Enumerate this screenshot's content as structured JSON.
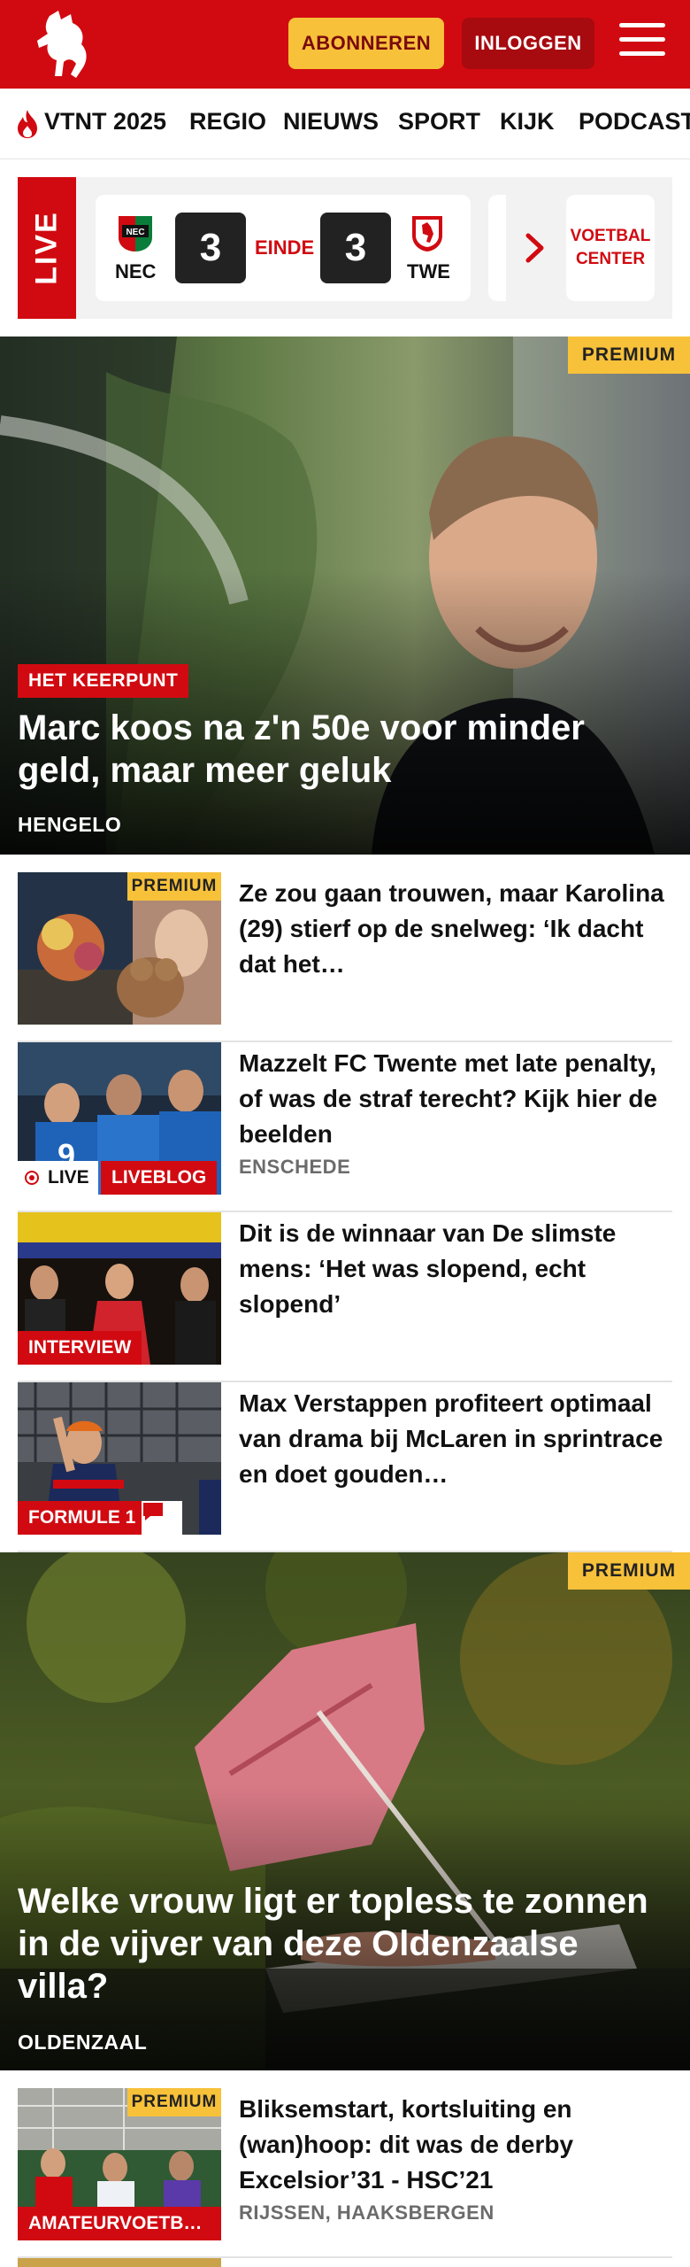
{
  "header": {
    "subscribe_label": "ABONNEREN",
    "login_label": "INLOGGEN",
    "brand_color": "#d10a11",
    "accent_color": "#f7c13a"
  },
  "nav": {
    "items": [
      {
        "label": "VTNT 2025",
        "icon": "flame-icon"
      },
      {
        "label": "REGIO"
      },
      {
        "label": "NIEUWS"
      },
      {
        "label": "SPORT"
      },
      {
        "label": "KIJK"
      },
      {
        "label": "PODCAST"
      }
    ]
  },
  "live": {
    "tag": "LIVE",
    "match": {
      "home_team": "NEC",
      "away_team": "TWE",
      "home_score": "3",
      "away_score": "3",
      "status": "EINDE"
    },
    "voetbal_center_line1": "VOETBAL",
    "voetbal_center_line2": "CENTER"
  },
  "hero1": {
    "premium": "PREMIUM",
    "label": "HET KEERPUNT",
    "title": "Marc koos na z'n 50e voor minder geld, maar meer geluk",
    "location": "HENGELO"
  },
  "articles": [
    {
      "premium": "PREMIUM",
      "title": "Ze zou gaan trouwen, maar Karolina (29) stierf op de snelweg: ‘Ik dacht dat het…"
    },
    {
      "live": "LIVE",
      "label": "LIVEBLOG",
      "title": "Mazzelt FC Twente met late penalty, of was de straf terecht? Kijk hier de beelden",
      "location": "ENSCHEDE"
    },
    {
      "label": "INTERVIEW",
      "title": "Dit is de winnaar van De slimste mens: ‘Het was slopend, echt slopend’"
    },
    {
      "label": "FORMULE 1",
      "comment_icon": "comment-icon",
      "title": "Max Verstappen profiteert optimaal van drama bij McLaren in sprintrace en doet gouden…"
    }
  ],
  "hero2": {
    "premium": "PREMIUM",
    "title": "Welke vrouw ligt er topless te zonnen in de vijver van deze Oldenzaalse villa?",
    "location": "OLDENZAAL"
  },
  "article_bottom": {
    "premium": "PREMIUM",
    "label": "AMATEURVOETB…",
    "title": "Bliksemstart, kortsluiting en (wan)hoop: dit was de derby Excelsior’31 - HSC’21",
    "location": "RIJSSEN, HAAKSBERGEN"
  }
}
